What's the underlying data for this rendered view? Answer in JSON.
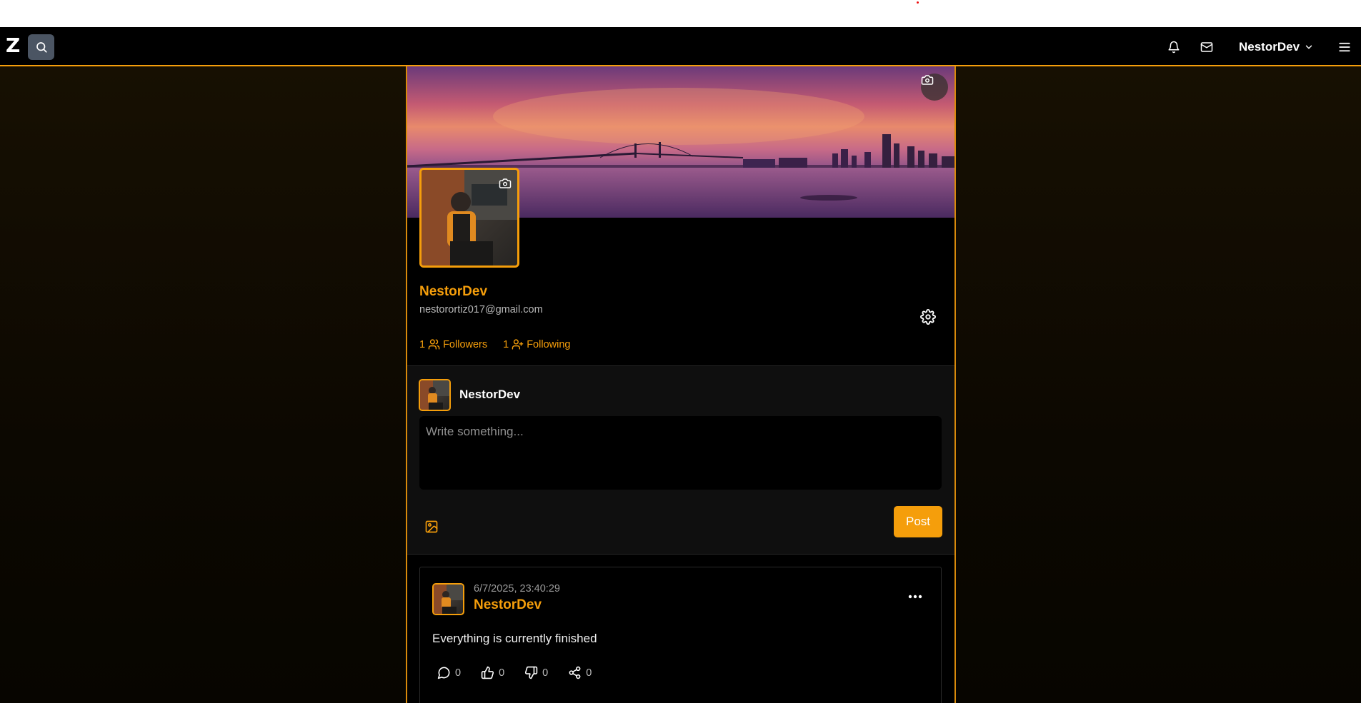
{
  "app": {
    "logo_letter": "Z",
    "accent_color": "#f59e0b"
  },
  "navbar": {
    "username": "NestorDev"
  },
  "profile": {
    "name": "NestorDev",
    "email": "nestorortiz017@gmail.com",
    "followers_count": "1",
    "followers_label": "Followers",
    "following_count": "1",
    "following_label": "Following"
  },
  "composer": {
    "author": "NestorDev",
    "placeholder": "Write something...",
    "post_label": "Post"
  },
  "posts": [
    {
      "date": "6/7/2025, 23:40:29",
      "author": "NestorDev",
      "text": "Everything is currently finished",
      "comments": "0",
      "likes": "0",
      "dislikes": "0",
      "shares": "0"
    }
  ],
  "icons": {
    "search": "search-icon",
    "bell": "bell-icon",
    "mail": "mail-icon",
    "chevron": "chevron-down-icon",
    "menu": "menu-icon",
    "camera": "camera-icon",
    "settings": "gear-icon",
    "image": "image-icon",
    "more": "more-icon",
    "comment": "comment-icon",
    "like": "thumbs-up-icon",
    "dislike": "thumbs-down-icon",
    "share": "share-icon"
  }
}
